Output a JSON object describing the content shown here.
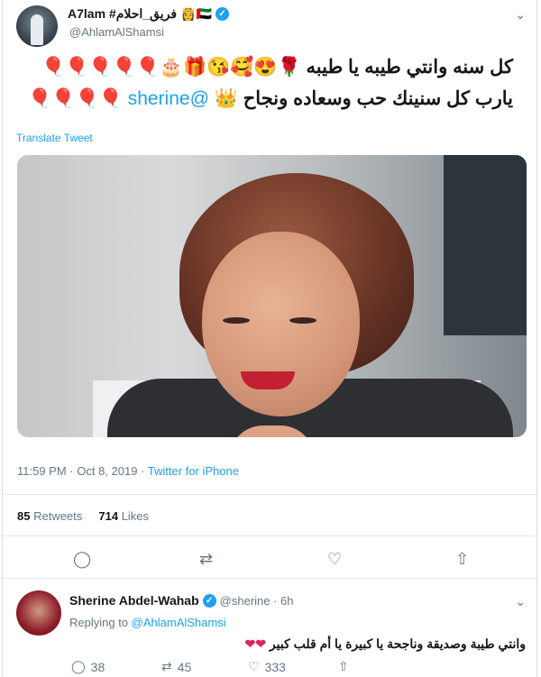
{
  "tweet": {
    "display_name": "A7lam #فريق_احلام",
    "flags": "👸🇦🇪",
    "handle": "@AhlamAlShamsi",
    "text_line1": "كل سنه وانتي طيبه يا طيبه 🌹😍🥰😘🎁🎂🎈🎈🎈🎈🎈",
    "text_line2_before": "يارب كل سنينك حب وسعاده ونجاح 👑",
    "mention": "@sherine",
    "text_line2_after": "🎈🎈🎈🎈",
    "translate_label": "Translate Tweet",
    "time": "11:59 PM · Oct 8, 2019 · ",
    "source": "Twitter for iPhone",
    "retweets_count": "85",
    "retweets_label": "Retweets",
    "likes_count": "714",
    "likes_label": "Likes"
  },
  "icons": {
    "chevron": "⌄",
    "reply": "◯",
    "retweet": "⇄",
    "like": "♡",
    "share": "⇧",
    "verified": "✓"
  },
  "reply": {
    "display_name": "Sherine Abdel-Wahab",
    "handle": "@sherine · 6h",
    "replying_prefix": "Replying to ",
    "replying_to": "@AhlamAlShamsi",
    "text": "وانتي طيبة وصديقة وناجحة يا كبيرة يا أم قلب كبير",
    "hearts": "❤❤",
    "replies": "38",
    "retweets": "45",
    "likes": "333"
  },
  "colors": {
    "accent": "#1da1f2",
    "muted": "#657786",
    "heart": "#e0245e"
  }
}
